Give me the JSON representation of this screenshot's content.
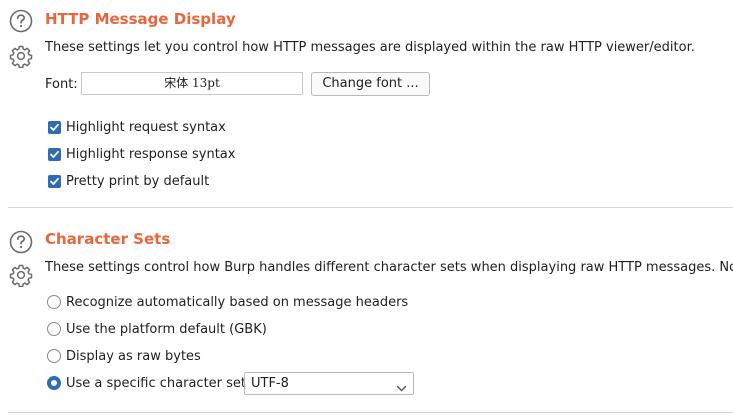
{
  "http_section": {
    "title": "HTTP Message Display",
    "description": "These settings let you control how HTTP messages are displayed within the raw HTTP viewer/editor.",
    "font_label": "Font:",
    "font_value": "宋体 13pt",
    "change_font_label": "Change font ...",
    "checkboxes": [
      {
        "label": "Highlight request syntax",
        "checked": true
      },
      {
        "label": "Highlight response syntax",
        "checked": true
      },
      {
        "label": "Pretty print by default",
        "checked": true
      }
    ]
  },
  "charset_section": {
    "title": "Character Sets",
    "description": "These settings control how Burp handles different character sets when displaying raw HTTP messages. Note that",
    "radios": [
      {
        "label": "Recognize automatically based on message headers",
        "selected": false
      },
      {
        "label": "Use the platform default (GBK)",
        "selected": false
      },
      {
        "label": "Display as raw bytes",
        "selected": false
      },
      {
        "label": "Use a specific character set:",
        "selected": true
      }
    ],
    "charset_value": "UTF-8"
  },
  "icons": {
    "help": "help-icon",
    "settings": "gear-icon",
    "checkmark": "checkmark-icon",
    "dropdown": "chevron-down-icon"
  },
  "colors": {
    "title_accent": "#e8673a",
    "control_blue": "#2d6bb3"
  }
}
